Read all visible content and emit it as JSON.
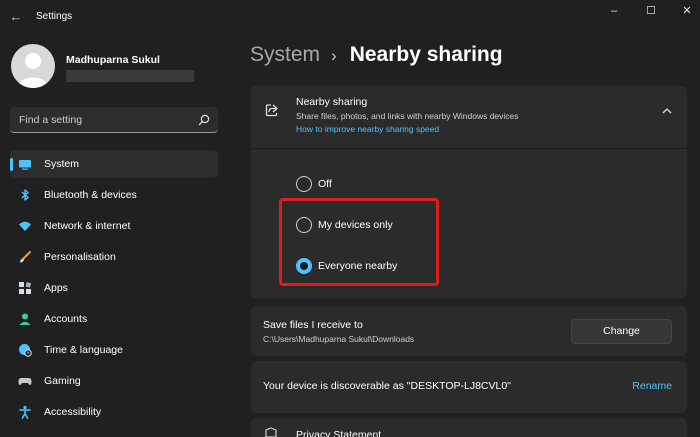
{
  "window": {
    "title": "Settings",
    "back_glyph": "←",
    "minimize_glyph": "–",
    "maximize_glyph": "☐",
    "close_glyph": "✕"
  },
  "profile": {
    "name": "Madhuparna Sukul"
  },
  "search": {
    "placeholder": "Find a setting",
    "icon": "search-icon"
  },
  "nav": {
    "items": [
      {
        "label": "System",
        "icon": "system-icon",
        "active": true
      },
      {
        "label": "Bluetooth & devices",
        "icon": "bluetooth-icon"
      },
      {
        "label": "Network & internet",
        "icon": "wifi-icon"
      },
      {
        "label": "Personalisation",
        "icon": "brush-icon"
      },
      {
        "label": "Apps",
        "icon": "apps-icon"
      },
      {
        "label": "Accounts",
        "icon": "accounts-icon"
      },
      {
        "label": "Time & language",
        "icon": "globe-clock-icon"
      },
      {
        "label": "Gaming",
        "icon": "gamepad-icon"
      },
      {
        "label": "Accessibility",
        "icon": "accessibility-icon"
      }
    ]
  },
  "page": {
    "breadcrumb_parent": "System",
    "breadcrumb_sep": "›",
    "title": "Nearby sharing"
  },
  "nearby": {
    "title": "Nearby sharing",
    "description": "Share files, photos, and links with nearby Windows devices",
    "link": "How to improve nearby sharing speed",
    "options": [
      {
        "label": "Off",
        "selected": false
      },
      {
        "label": "My devices only",
        "selected": false
      },
      {
        "label": "Everyone nearby",
        "selected": true
      }
    ]
  },
  "save_files": {
    "title": "Save files I receive to",
    "path": "C:\\Users\\Madhuparna Sukul\\Downloads",
    "button": "Change"
  },
  "discoverable": {
    "text": "Your device is discoverable as \"DESKTOP-LJ8CVL0\"",
    "link": "Rename"
  },
  "privacy": {
    "title": "Privacy Statement"
  },
  "colors": {
    "accent": "#4cc2ff",
    "background": "#202020",
    "card": "#2b2b2b",
    "highlight_box": "#e01b1b"
  }
}
